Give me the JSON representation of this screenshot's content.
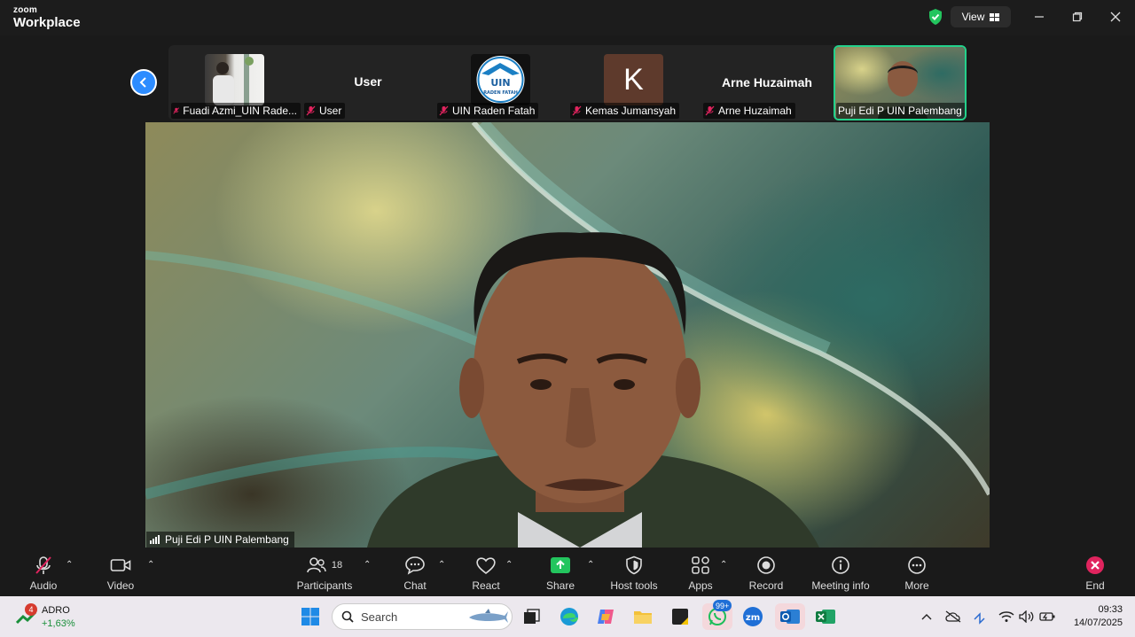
{
  "titlebar": {
    "brand_small": "zoom",
    "brand_big": "Workplace",
    "view_label": "View",
    "security_color": "#23c55e"
  },
  "gallery": {
    "tiles": [
      {
        "name": "Fuadi Azmi_UIN Rade...",
        "type": "photo"
      },
      {
        "name": "User",
        "display": "User",
        "type": "text"
      },
      {
        "name": "UIN Raden Fatah",
        "type": "logo",
        "logo_text": "UIN",
        "logo_sub": "RADEN FATAH"
      },
      {
        "name": "Kemas Jumansyah",
        "type": "initial",
        "initial": "K"
      },
      {
        "name": "Arne Huzaimah",
        "display": "Arne Huzaimah",
        "type": "text"
      },
      {
        "name": "Puji Edi P UIN Palembang",
        "type": "video",
        "active": true
      }
    ]
  },
  "main_video": {
    "speaker_name": "Puji Edi P UIN Palembang"
  },
  "toolbar": {
    "audio": "Audio",
    "video": "Video",
    "participants": "Participants",
    "participants_count": "18",
    "chat": "Chat",
    "react": "React",
    "share": "Share",
    "host_tools": "Host tools",
    "apps": "Apps",
    "record": "Record",
    "meeting_info": "Meeting info",
    "more": "More",
    "end": "End",
    "share_color": "#23c55e",
    "end_color": "#e0245e"
  },
  "taskbar": {
    "stock_badge": "4",
    "stock_name": "ADRO",
    "stock_change": "+1,63%",
    "search_placeholder": "Search",
    "whatsapp_badge": "99+",
    "time": "09:33",
    "date": "14/07/2025"
  }
}
